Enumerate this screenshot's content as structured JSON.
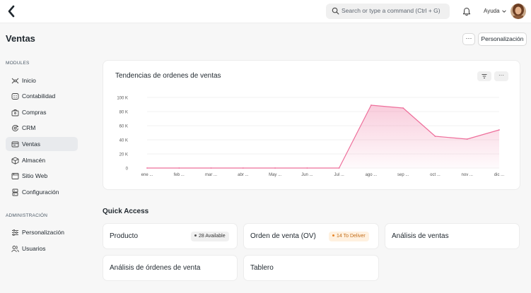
{
  "topbar": {
    "search_placeholder": "Search or type a command (Ctrl + G)",
    "help_label": "Ayuda"
  },
  "page": {
    "title": "Ventas",
    "more_label": "···",
    "customize_label": "Personalización"
  },
  "sidebar": {
    "modules_label": "MODULES",
    "modules": [
      {
        "label": "Inicio",
        "icon": "home-icon"
      },
      {
        "label": "Contabilidad",
        "icon": "accounting-icon"
      },
      {
        "label": "Compras",
        "icon": "bag-icon"
      },
      {
        "label": "CRM",
        "icon": "crm-icon"
      },
      {
        "label": "Ventas",
        "icon": "sales-icon",
        "active": true
      },
      {
        "label": "Almacén",
        "icon": "box-icon"
      },
      {
        "label": "Sitio Web",
        "icon": "browser-icon"
      },
      {
        "label": "Configuración",
        "icon": "database-icon"
      }
    ],
    "admin_label": "ADMINISTRACIÓN",
    "admin": [
      {
        "label": "Personalización",
        "icon": "sliders-icon"
      },
      {
        "label": "Usuarios",
        "icon": "users-icon"
      }
    ]
  },
  "chart_card": {
    "title": "Tendencias de ordenes de ventas",
    "filter_icon": "filter-icon",
    "more_label": "···"
  },
  "chart_data": {
    "type": "area",
    "title": "Tendencias de ordenes de ventas",
    "categories": [
      "ene ...",
      "feb ...",
      "mar ...",
      "abr ...",
      "May ...",
      "Jun ...",
      "Jul ...",
      "ago ...",
      "sep ...",
      "oct ...",
      "nov ...",
      "dic ..."
    ],
    "y_tick_labels": [
      "0",
      "20 K",
      "40 K",
      "60 K",
      "80 K",
      "100 K"
    ],
    "y_ticks": [
      0,
      20000,
      40000,
      60000,
      80000,
      100000
    ],
    "ylim": [
      0,
      100000
    ],
    "series": [
      {
        "values": [
          0,
          0,
          0,
          0,
          0,
          0,
          0,
          89000,
          85000,
          45000,
          41000,
          54000
        ]
      }
    ],
    "color": "#ee6f9b",
    "grid": true,
    "legend": "none"
  },
  "quick_access": {
    "title": "Quick Access",
    "cards": [
      {
        "label": "Producto",
        "badge": "28 Available",
        "badge_style": "gray"
      },
      {
        "label": "Orden de venta (OV)",
        "badge": "14 To Deliver",
        "badge_style": "orange"
      },
      {
        "label": "Análisis de ventas"
      },
      {
        "label": "Análisis de órdenes de venta"
      },
      {
        "label": "Tablero"
      }
    ]
  }
}
